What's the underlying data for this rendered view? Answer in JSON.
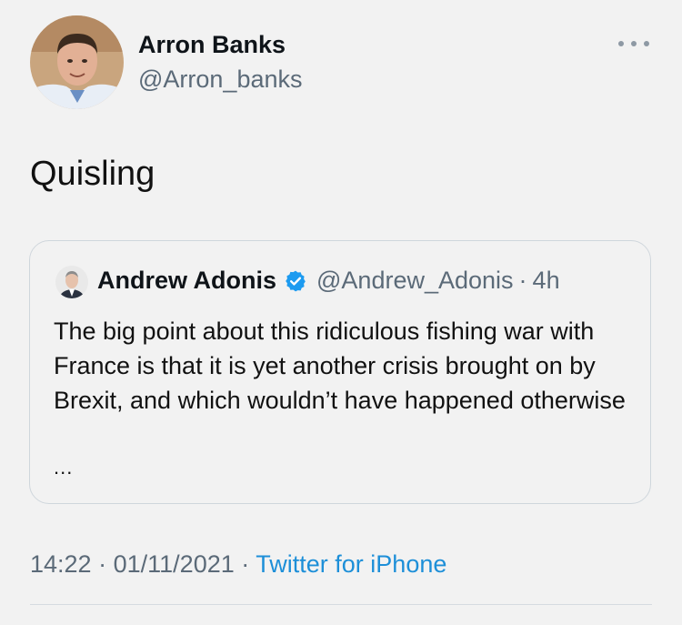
{
  "tweet": {
    "author_name": "Arron Banks",
    "author_handle": "@Arron_banks",
    "text": "Quisling",
    "more_icon": "more-horizontal-icon",
    "timestamp_time": "14:22",
    "timestamp_sep1": "·",
    "timestamp_date": "01/11/2021",
    "timestamp_sep2": "·",
    "source_app": "Twitter for iPhone"
  },
  "quoted_tweet": {
    "author_name": "Andrew Adonis",
    "verified_icon": "verified-badge-icon",
    "author_handle": "@Andrew_Adonis",
    "separator": "·",
    "time_ago": "4h",
    "text": "The big point about this ridiculous fishing war with France is that it is yet another crisis brought on by Brexit, and which wouldn’t have happened otherwise",
    "ellipsis": "..."
  },
  "colors": {
    "background": "#f2f2f2",
    "secondary_text": "#5b6a78",
    "link": "#1d8fd8",
    "verified": "#1d9bf0"
  }
}
